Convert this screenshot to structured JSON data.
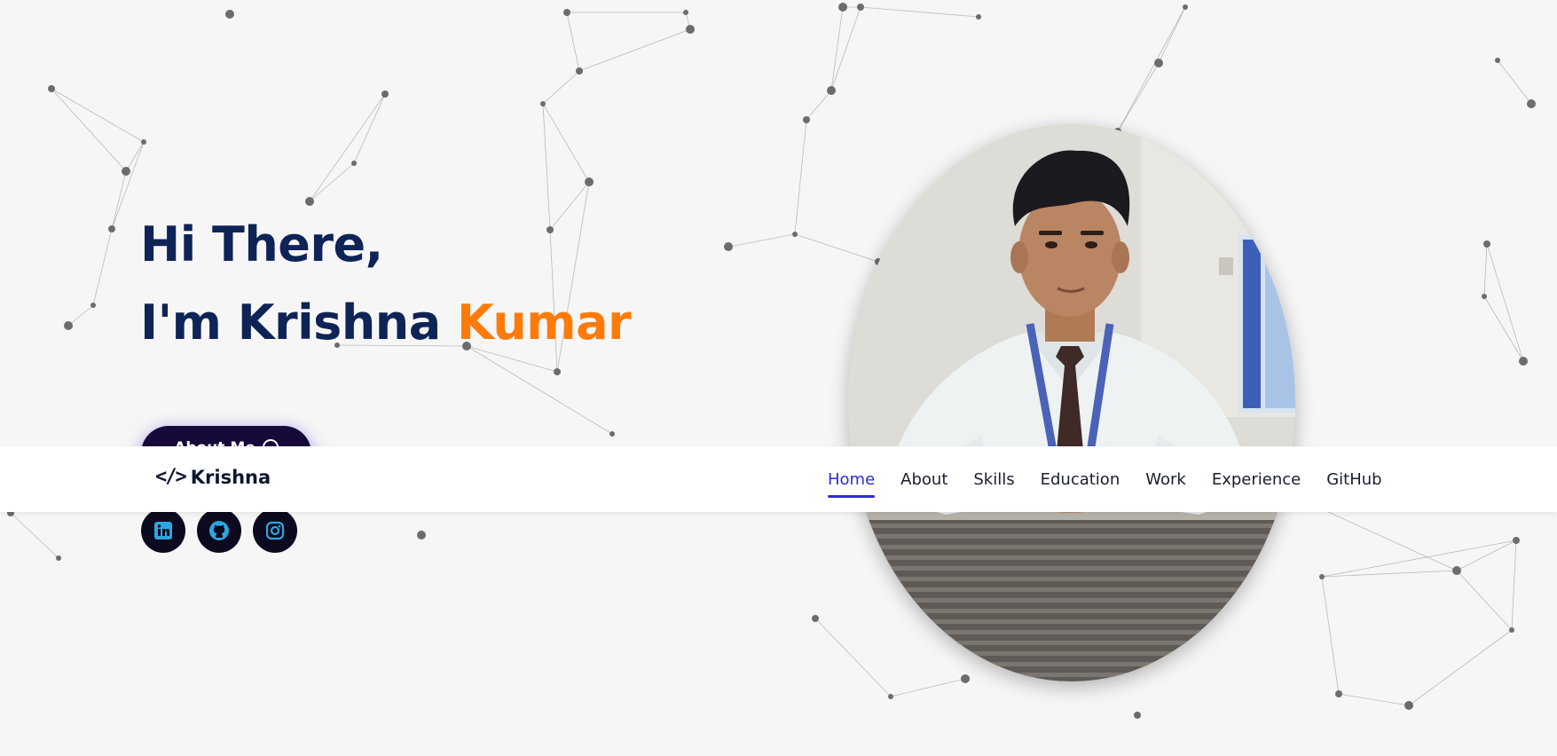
{
  "hero": {
    "greeting": "Hi There,",
    "intro_prefix": "I'm Krishna",
    "intro_accent": "Kumar",
    "about_button_label": "About Me"
  },
  "social": [
    {
      "name": "LinkedIn",
      "icon": "linkedin-icon"
    },
    {
      "name": "GitHub",
      "icon": "github-icon"
    },
    {
      "name": "Instagram",
      "icon": "instagram-icon"
    }
  ],
  "navbar": {
    "brand_icon": "</>",
    "brand": "Krishna",
    "links": [
      {
        "label": "Home",
        "active": true
      },
      {
        "label": "About",
        "active": false
      },
      {
        "label": "Skills",
        "active": false
      },
      {
        "label": "Education",
        "active": false
      },
      {
        "label": "Work",
        "active": false
      },
      {
        "label": "Experience",
        "active": false
      },
      {
        "label": "GitHub",
        "active": false
      }
    ]
  },
  "colors": {
    "heading": "#0e2356",
    "accent": "#ff7b09",
    "nav_active": "#2b2ecf",
    "button_bg": "#150a3a",
    "social_icon": "#2aa7e0"
  }
}
